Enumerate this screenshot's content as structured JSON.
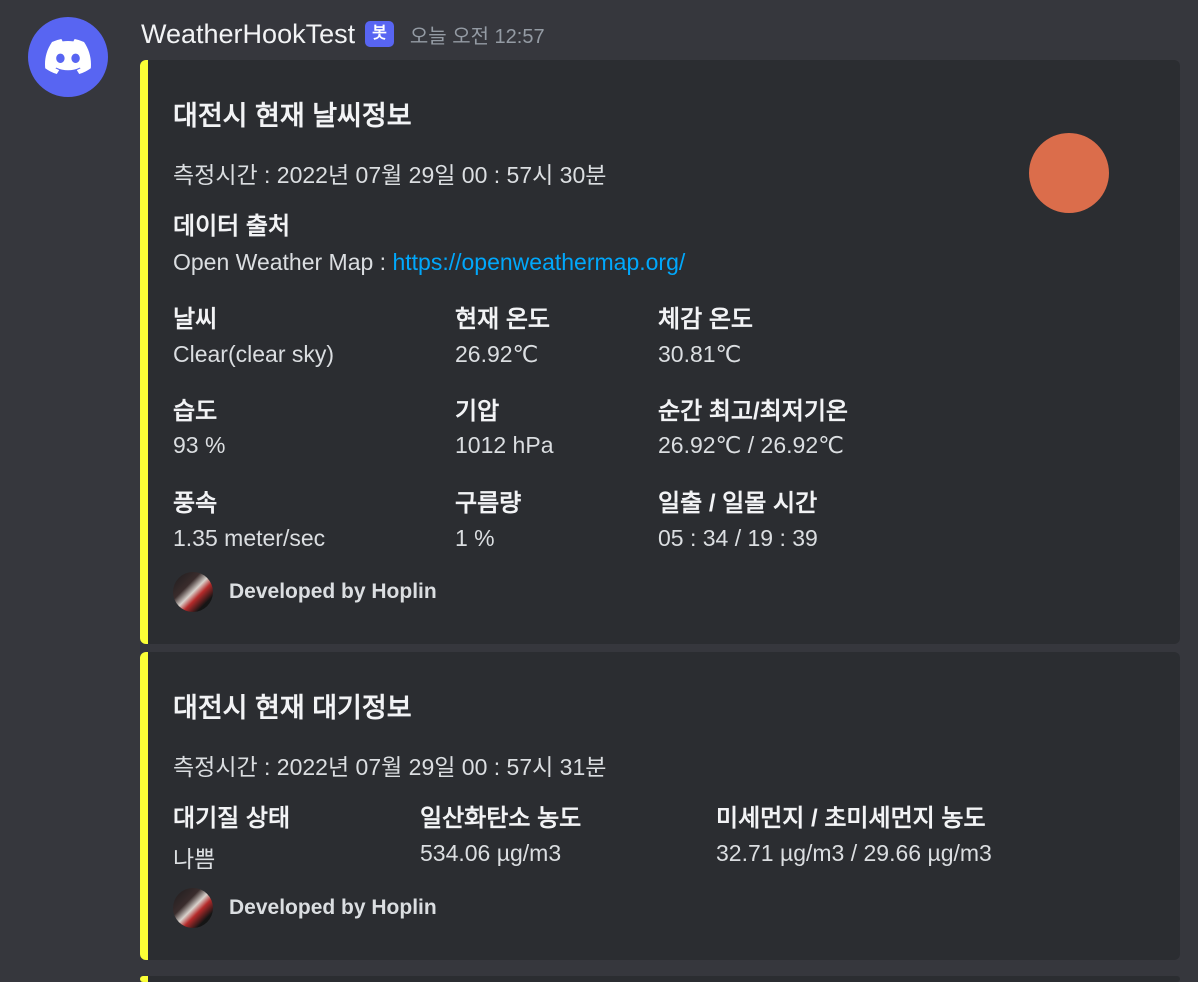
{
  "message": {
    "username": "WeatherHookTest",
    "bot_tag": "봇",
    "timestamp": "오늘 오전 12:57"
  },
  "embed_weather": {
    "title": "대전시 현재 날씨정보",
    "measured": "측정시간 : 2022년 07월 29일 00 : 57시 30분",
    "source_title": "데이터 출처",
    "source_text": "Open Weather Map : ",
    "source_link": "https://openweathermap.org/",
    "fields": [
      {
        "name": "날씨",
        "value": "Clear(clear sky)"
      },
      {
        "name": "현재 온도",
        "value": "26.92℃"
      },
      {
        "name": "체감 온도",
        "value": "30.81℃"
      },
      {
        "name": "습도",
        "value": "93 %"
      },
      {
        "name": "기압",
        "value": "1012 hPa"
      },
      {
        "name": "순간 최고/최저기온",
        "value": "26.92℃ / 26.92℃"
      },
      {
        "name": "풍속",
        "value": "1.35 meter/sec"
      },
      {
        "name": "구름량",
        "value": "1 %"
      },
      {
        "name": "일출 / 일몰 시간",
        "value": "05 : 34 / 19 : 39"
      }
    ],
    "footer": "Developed by Hoplin",
    "accent_color": "#fbff36",
    "thumbnail_color": "#db6d4b"
  },
  "embed_air": {
    "title": "대전시 현재 대기정보",
    "measured": "측정시간 : 2022년 07월 29일 00 : 57시 31분",
    "fields": [
      {
        "name": "대기질 상태",
        "value": "나쁨"
      },
      {
        "name": "일산화탄소 농도",
        "value": "534.06 µg/m3"
      },
      {
        "name": "미세먼지 / 초미세먼지 농도",
        "value": "32.71 µg/m3 / 29.66 µg/m3"
      }
    ],
    "footer": "Developed by Hoplin",
    "accent_color": "#fbff36"
  }
}
